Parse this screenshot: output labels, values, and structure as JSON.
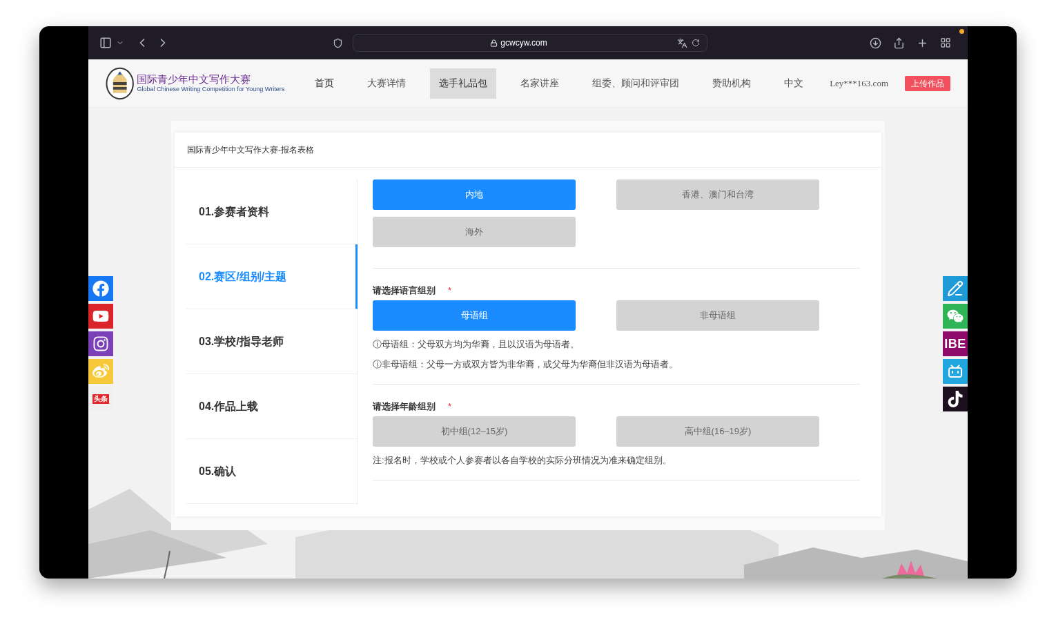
{
  "browser": {
    "url": "gcwcyw.com"
  },
  "site": {
    "logo_title": "国际青少年中文写作大赛",
    "logo_subtitle": "Global Chinese Writing Competition for Young Writers",
    "nav": [
      {
        "label": "首页",
        "selected": false
      },
      {
        "label": "大赛详情",
        "selected": false
      },
      {
        "label": "选手礼品包",
        "selected": true
      },
      {
        "label": "名家讲座",
        "selected": false
      },
      {
        "label": "组委、顾问和评审团",
        "selected": false
      },
      {
        "label": "赞助机构",
        "selected": false
      },
      {
        "label": "中文",
        "selected": false
      }
    ],
    "user": "Ley***163.com",
    "upload_button": "上传作品"
  },
  "form": {
    "title": "国际青少年中文写作大赛-报名表格",
    "steps": [
      {
        "label": "01.参赛者资料",
        "selected": false
      },
      {
        "label": "02.赛区/组别/主题",
        "selected": true
      },
      {
        "label": "03.学校/指导老师",
        "selected": false
      },
      {
        "label": "04.作品上载",
        "selected": false
      },
      {
        "label": "05.确认",
        "selected": false
      }
    ],
    "sections": [
      {
        "options": [
          {
            "label": "内地",
            "selected": true
          },
          {
            "label": "香港、澳门和台湾",
            "selected": false
          },
          {
            "label": "海外",
            "selected": false
          }
        ]
      },
      {
        "label": "请选择语言组别",
        "required_mark": "*",
        "options": [
          {
            "label": "母语组",
            "selected": true
          },
          {
            "label": "非母语组",
            "selected": false
          }
        ],
        "notes": [
          "ⓘ母语组：父母双方均为华裔，且以汉语为母语者。",
          "ⓘ非母语组：父母一方或双方皆为非华裔，或父母为华裔但非汉语为母语者。"
        ]
      },
      {
        "label": "请选择年龄组别",
        "required_mark": "*",
        "options": [
          {
            "label": "初中组(12–15岁)",
            "selected": false
          },
          {
            "label": "高中组(16–19岁)",
            "selected": false
          }
        ],
        "notes": [
          "注:报名时，学校或个人参赛者以各自学校的实际分班情况为准来确定组别。"
        ]
      }
    ]
  },
  "social_left": [
    {
      "kind": "facebook"
    },
    {
      "kind": "youtube"
    },
    {
      "kind": "instagram"
    },
    {
      "kind": "weibo"
    },
    {
      "kind": "toutiao",
      "text": "头条"
    }
  ],
  "social_right": [
    {
      "kind": "pen"
    },
    {
      "kind": "wechat"
    },
    {
      "kind": "ibe",
      "text": "IBE"
    },
    {
      "kind": "bilibili"
    },
    {
      "kind": "tiktok"
    }
  ]
}
